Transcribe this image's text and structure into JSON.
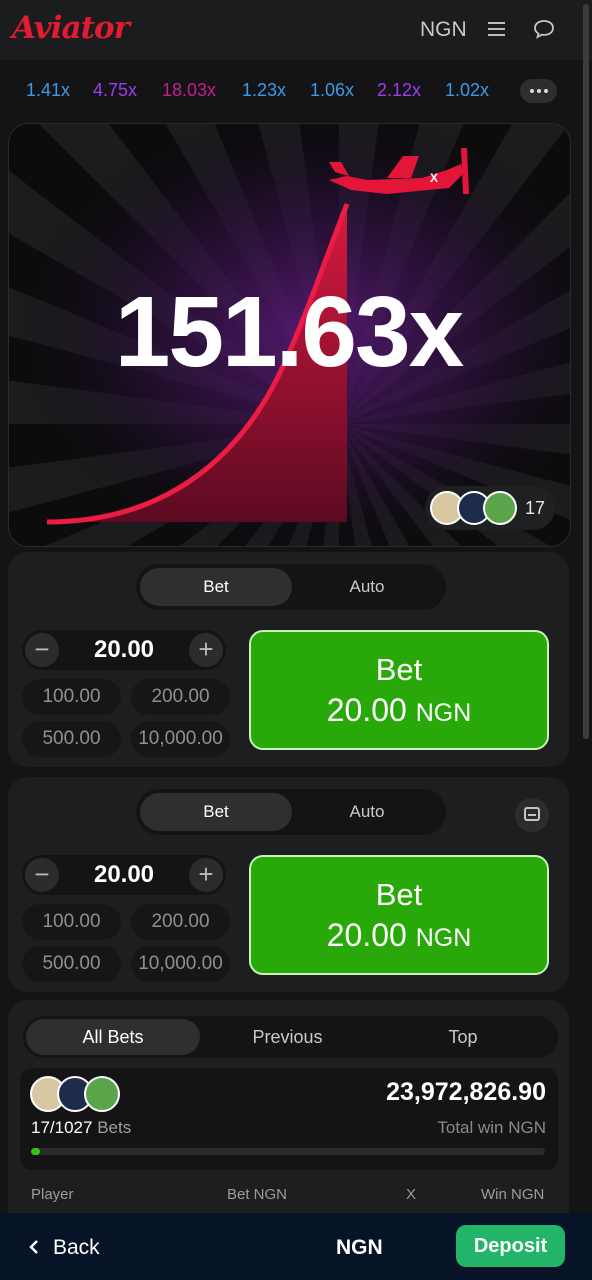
{
  "header": {
    "logo": "Aviator",
    "currency": "NGN"
  },
  "history": [
    {
      "value": "1.41x",
      "color": "#3a9be6"
    },
    {
      "value": "4.75x",
      "color": "#9d3cf0"
    },
    {
      "value": "18.03x",
      "color": "#c51f8e"
    },
    {
      "value": "1.23x",
      "color": "#3a9be6"
    },
    {
      "value": "1.06x",
      "color": "#3a9be6"
    },
    {
      "value": "2.12x",
      "color": "#9d3cf0"
    },
    {
      "value": "1.02x",
      "color": "#3a9be6"
    }
  ],
  "game": {
    "multiplier": "151.63x",
    "players_count": "17",
    "plane_mark": "X"
  },
  "bet_panels": [
    {
      "tabs": [
        "Bet",
        "Auto"
      ],
      "active_tab": "Bet",
      "amount": "20.00",
      "quick_amounts": [
        "100.00",
        "200.00",
        "500.00",
        "10,000.00"
      ],
      "button_label": "Bet",
      "button_amount": "20.00",
      "button_currency": "NGN"
    },
    {
      "tabs": [
        "Bet",
        "Auto"
      ],
      "active_tab": "Bet",
      "amount": "20.00",
      "quick_amounts": [
        "100.00",
        "200.00",
        "500.00",
        "10,000.00"
      ],
      "button_label": "Bet",
      "button_amount": "20.00",
      "button_currency": "NGN"
    }
  ],
  "bets": {
    "tabs": [
      "All Bets",
      "Previous",
      "Top"
    ],
    "active_tab": "All Bets",
    "count": "17/1027",
    "count_label": "Bets",
    "total_win": "23,972,826.90",
    "total_win_label": "Total win NGN",
    "progress_fraction": 0.017,
    "columns": [
      "Player",
      "Bet NGN",
      "X",
      "Win NGN"
    ]
  },
  "footer": {
    "back": "Back",
    "currency": "NGN",
    "deposit": "Deposit"
  },
  "colors": {
    "brand_red": "#e11b31",
    "bet_green": "#28a909",
    "deposit_green": "#22b469",
    "footer_bg": "#071427"
  }
}
